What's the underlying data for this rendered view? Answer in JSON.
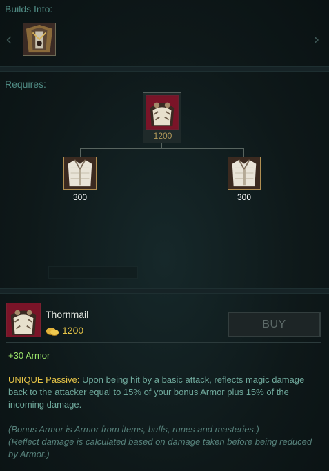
{
  "builds_into": {
    "label": "Builds Into:",
    "left_arrow": "‹",
    "right_arrow": "›",
    "items": [
      {
        "icon": "thornmail-upgrade-icon"
      }
    ]
  },
  "requires": {
    "label": "Requires:",
    "root": {
      "icon": "thornmail-icon",
      "cost": "1200"
    },
    "children": [
      {
        "icon": "chain-vest-icon",
        "cost": "300"
      },
      {
        "icon": "chain-vest-icon",
        "cost": "300"
      }
    ]
  },
  "item": {
    "name": "Thornmail",
    "cost": "1200",
    "icon": "thornmail-icon",
    "gold_icon": "gold-coin-icon",
    "buy_label": "BUY",
    "stat": "+30 Armor",
    "passive_label": "UNIQUE Passive:",
    "passive_text": "Upon being hit by a basic attack, reflects magic damage back to the attacker equal to 15% of your bonus Armor plus 15% of the incoming damage.",
    "note_1": "(Bonus Armor is Armor from items, buffs, runes and masteries.)",
    "note_2": "(Reflect damage is calculated based on damage taken before being reduced by Armor.)"
  },
  "colors": {
    "label": "#4f8a83",
    "cost_root": "#b39a5b",
    "cost_child": "#ffffff",
    "gold_text": "#e5c347",
    "stat_green": "#9be56a",
    "body_teal": "#6fa89b"
  }
}
